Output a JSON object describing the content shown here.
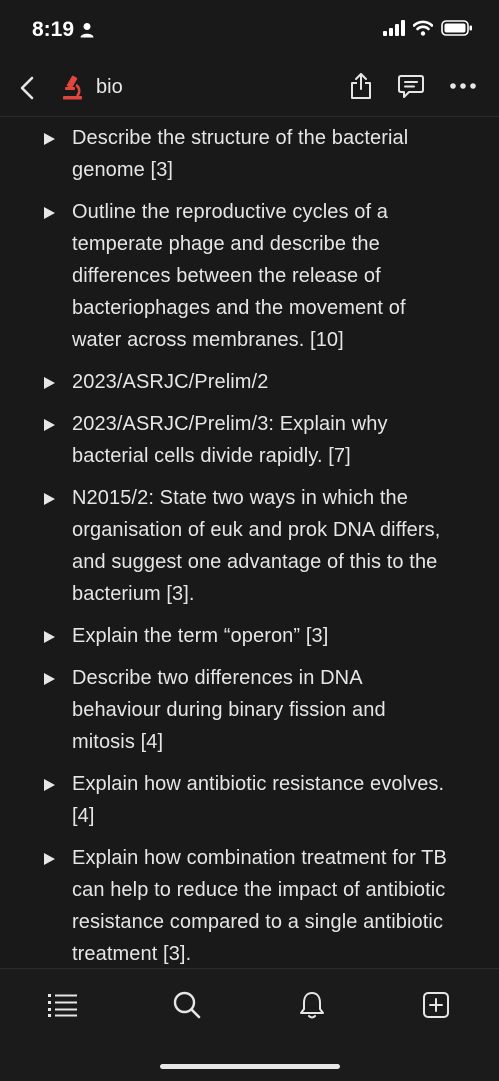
{
  "status": {
    "time": "8:19"
  },
  "nav": {
    "title": "bio",
    "icons": [
      "back-chevron-icon",
      "microscope-icon",
      "share-icon",
      "comment-icon",
      "more-icon"
    ]
  },
  "toggles": [
    {
      "text": "Describe the structure of the bacterial genome [3]"
    },
    {
      "text": "Outline the reproductive cycles of a temperate phage and describe the differences between the release of bacteriophages and the movement of water across membranes. [10]"
    },
    {
      "text": "2023/ASRJC/Prelim/2"
    },
    {
      "text": "2023/ASRJC/Prelim/3: Explain why bacterial cells divide rapidly. [7]"
    },
    {
      "text": "N2015/2: State two ways in which the organisation of euk and prok DNA differs, and suggest one advantage of this to the bacterium [3]."
    },
    {
      "text": "Explain the term “operon” [3]"
    },
    {
      "text": "Describe two differences in DNA behaviour during binary fission and mitosis [4]"
    },
    {
      "text": "Explain how antibiotic resistance evolves. [4]"
    },
    {
      "text": "Explain how combination treatment for TB can help to reduce the impact of antibiotic resistance compared to a single antibiotic treatment [3]."
    }
  ],
  "tab_bar": {
    "icons": [
      "list-icon",
      "search-icon",
      "bell-icon",
      "new-page-icon"
    ]
  },
  "colors": {
    "background": "#191919",
    "text": "#e6e6e6",
    "accent": "#e0463e"
  }
}
